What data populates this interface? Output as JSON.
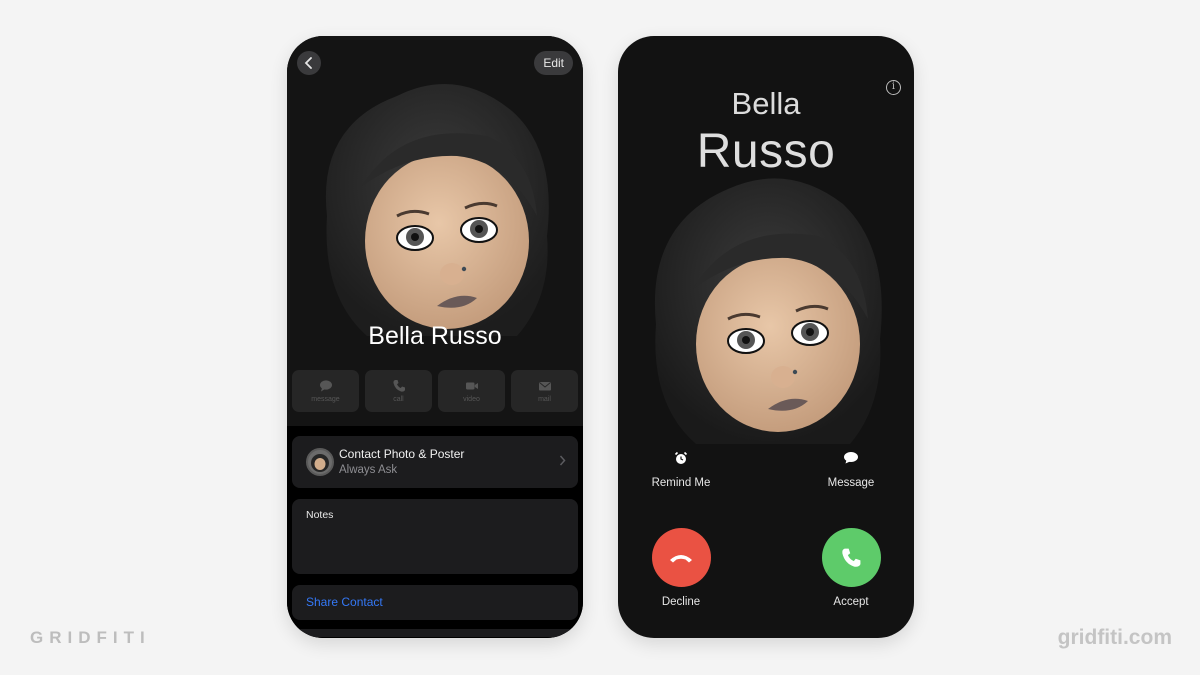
{
  "watermark": {
    "left": "GRIDFITI",
    "right": "gridfiti.com"
  },
  "contact_card": {
    "back_icon": "chevron-left-icon",
    "edit_label": "Edit",
    "name": "Bella Russo",
    "actions": [
      {
        "label": "message",
        "icon": "message-bubble-icon"
      },
      {
        "label": "call",
        "icon": "phone-icon"
      },
      {
        "label": "video",
        "icon": "video-camera-icon"
      },
      {
        "label": "mail",
        "icon": "envelope-icon"
      }
    ],
    "poster_row": {
      "title": "Contact Photo & Poster",
      "subtitle": "Always Ask",
      "icon": "chevron-right-icon"
    },
    "notes_label": "Notes",
    "share_label": "Share Contact",
    "colors": {
      "link": "#3478f6",
      "card": "#1c1c1e"
    }
  },
  "incoming_call": {
    "info_icon": "info-icon",
    "first_name": "Bella",
    "last_name": "Russo",
    "quick_actions": [
      {
        "label": "Remind Me",
        "icon": "alarm-clock-icon"
      },
      {
        "label": "Message",
        "icon": "message-bubble-icon"
      }
    ],
    "decline_label": "Decline",
    "accept_label": "Accept",
    "colors": {
      "decline": "#ea5243",
      "accept": "#5ecb6a"
    }
  }
}
